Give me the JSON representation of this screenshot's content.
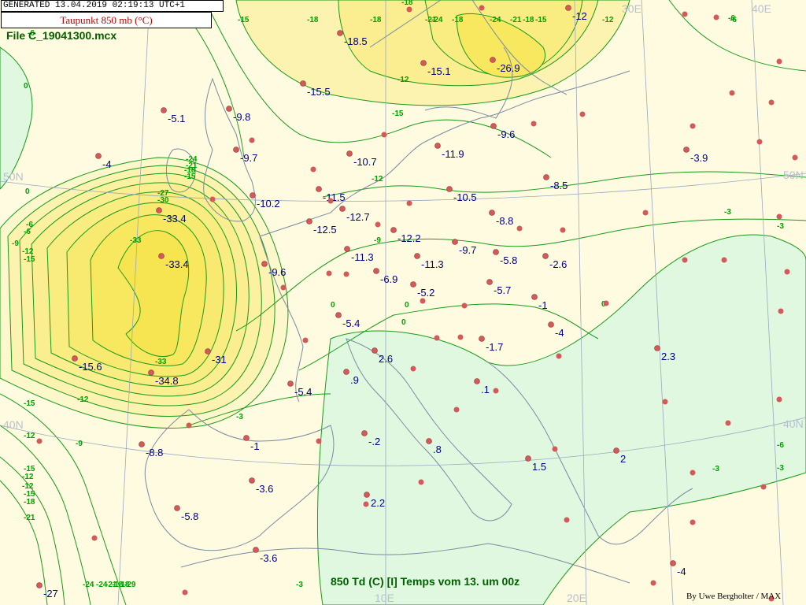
{
  "header": {
    "generated": "GENERATED 13.04.2019 02:19:13 UTC+1",
    "subtitle": "Taupunkt 850 mb (°C)",
    "file": "File C_19041300.mcx"
  },
  "caption": "850 Td (C) [I]  Temps vom 13. um 00z",
  "credit": "By Uwe Bergholter / MAX",
  "grid_labels": [
    "30E",
    "40E",
    "50N",
    "50N",
    "40N",
    "40N",
    "10E",
    "20E"
  ],
  "stations": [
    {
      "value": "-18.5"
    },
    {
      "value": "-15.1"
    },
    {
      "value": "-26.9"
    },
    {
      "value": "-12"
    },
    {
      "value": "-15.5"
    },
    {
      "value": "-5.1"
    },
    {
      "value": "-9.8"
    },
    {
      "value": "-9.6"
    },
    {
      "value": "-11.9"
    },
    {
      "value": "-4"
    },
    {
      "value": "-9.7"
    },
    {
      "value": "-10.7"
    },
    {
      "value": "-3.9"
    },
    {
      "value": "-8.5"
    },
    {
      "value": "-11.5"
    },
    {
      "value": "-10.5"
    },
    {
      "value": "-33.4"
    },
    {
      "value": "-10.2"
    },
    {
      "value": "-12.7"
    },
    {
      "value": "-8.8"
    },
    {
      "value": "-12.5"
    },
    {
      "value": "-12.2"
    },
    {
      "value": "-9.7"
    },
    {
      "value": "-11.3"
    },
    {
      "value": "-5.8"
    },
    {
      "value": "-33.4"
    },
    {
      "value": "-11.3"
    },
    {
      "value": "-2.6"
    },
    {
      "value": "-9.6"
    },
    {
      "value": "-6.9"
    },
    {
      "value": "-5.2"
    },
    {
      "value": "-5.7"
    },
    {
      "value": "-1"
    },
    {
      "value": "-5.4"
    },
    {
      "value": "-4"
    },
    {
      "value": "-1.7"
    },
    {
      "value": "-31"
    },
    {
      "value": "2.3"
    },
    {
      "value": "2.6"
    },
    {
      "value": "-15.6"
    },
    {
      "value": ".9"
    },
    {
      "value": "-34.8"
    },
    {
      "value": "-5.4"
    },
    {
      "value": ".1"
    },
    {
      "value": "-.2"
    },
    {
      "value": "-1"
    },
    {
      "value": "-8.8"
    },
    {
      "value": ".8"
    },
    {
      "value": "2"
    },
    {
      "value": "1.5"
    },
    {
      "value": "-3.6"
    },
    {
      "value": "2.2"
    },
    {
      "value": "-5.8"
    },
    {
      "value": "-3.6"
    },
    {
      "value": "-4"
    },
    {
      "value": "-27"
    }
  ],
  "contour_labels": [
    "-15",
    "-18",
    "-18",
    "-18",
    "-18",
    "-21",
    "-24",
    "-24",
    "-21",
    "-18",
    "-15",
    "-12",
    "-6",
    "-15",
    "-12",
    "-9",
    "-12",
    "-15",
    "-18",
    "-21",
    "-24",
    "-27",
    "-30",
    "-33",
    "-33",
    "-12",
    "-9",
    "-6",
    "-3",
    "-3",
    "-6",
    "-9",
    "-12",
    "-15",
    "-15",
    "-12",
    "-15",
    "-12",
    "-12",
    "-15",
    "-18",
    "-21",
    "-24",
    "-24",
    "-21",
    "-18",
    "-18",
    "-29",
    "-6",
    "-3",
    "-3",
    "-3",
    "-3",
    "0",
    "0",
    "0",
    "0",
    "0",
    "0",
    "-6",
    "-6"
  ],
  "colors": {
    "background": "#fffbe0",
    "band_light": "#fdf8cc",
    "band_mid": "#fcf3b0",
    "band_dark": "#faf090",
    "band_peak": "#f8ec60",
    "positive_area": "#e0f8e0",
    "contour": "#1a9a1a",
    "coast": "#7a8aa0",
    "station_dot": "#d45a5a",
    "station_text": "#000080",
    "contour_text": "#00a000"
  }
}
